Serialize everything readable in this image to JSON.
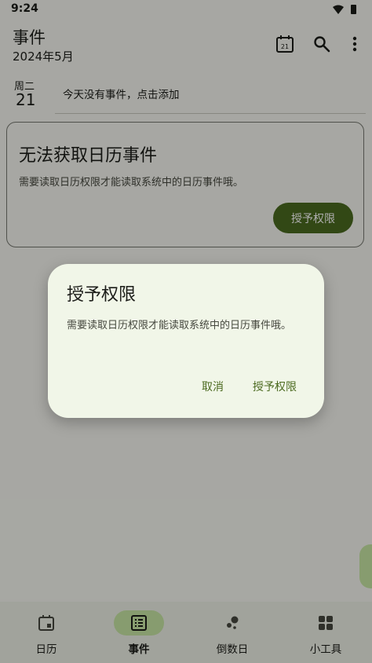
{
  "status_bar": {
    "time": "9:24"
  },
  "app_bar": {
    "title": "事件",
    "subtitle": "2024年5月",
    "calendar_icon_day": "21"
  },
  "day": {
    "weekday": "周二",
    "date": "21",
    "empty_message": "今天没有事件，点击添加"
  },
  "permission_card": {
    "title": "无法获取日历事件",
    "body": "需要读取日历权限才能读取系统中的日历事件哦。",
    "button": "授予权限"
  },
  "dialog": {
    "title": "授予权限",
    "body": "需要读取日历权限才能读取系统中的日历事件哦。",
    "cancel": "取消",
    "confirm": "授予权限"
  },
  "bottom_nav": {
    "items": [
      {
        "label": "日历",
        "icon": "calendar-icon"
      },
      {
        "label": "事件",
        "icon": "event-list-icon",
        "active": true
      },
      {
        "label": "倒数日",
        "icon": "countdown-icon"
      },
      {
        "label": "小工具",
        "icon": "widgets-icon"
      }
    ]
  },
  "colors": {
    "primary": "#4b6a1f",
    "surface": "#f6f7f0",
    "active_indicator": "#c8e6a4",
    "dialog_surface": "#f1f6e8"
  }
}
